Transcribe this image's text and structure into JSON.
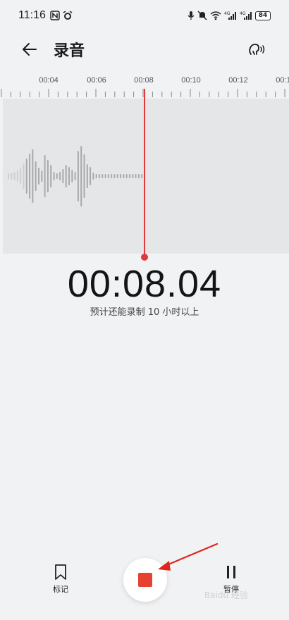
{
  "status_bar": {
    "time": "11:16",
    "battery": "84",
    "left_icons": [
      "nfc-icon",
      "alarm-icon"
    ],
    "right_icons": [
      "mic-icon",
      "mute-icon",
      "wifi-icon",
      "signal-4g-icon",
      "signal-4g-icon"
    ]
  },
  "header": {
    "title": "录音"
  },
  "timeline": {
    "labels": [
      "00:04",
      "00:06",
      "00:08",
      "00:10",
      "00:12",
      "00:1"
    ]
  },
  "recorder": {
    "elapsed": "00:08.04",
    "remaining_text": "预计还能录制 10 小时以上"
  },
  "bottom": {
    "mark_label": "标记",
    "pause_label": "暂停"
  },
  "colors": {
    "accent": "#e0393b",
    "stop": "#e5432f",
    "background": "#f1f2f4",
    "wave_bg": "#e5e6e8"
  },
  "watermark": "Baidu 经验"
}
